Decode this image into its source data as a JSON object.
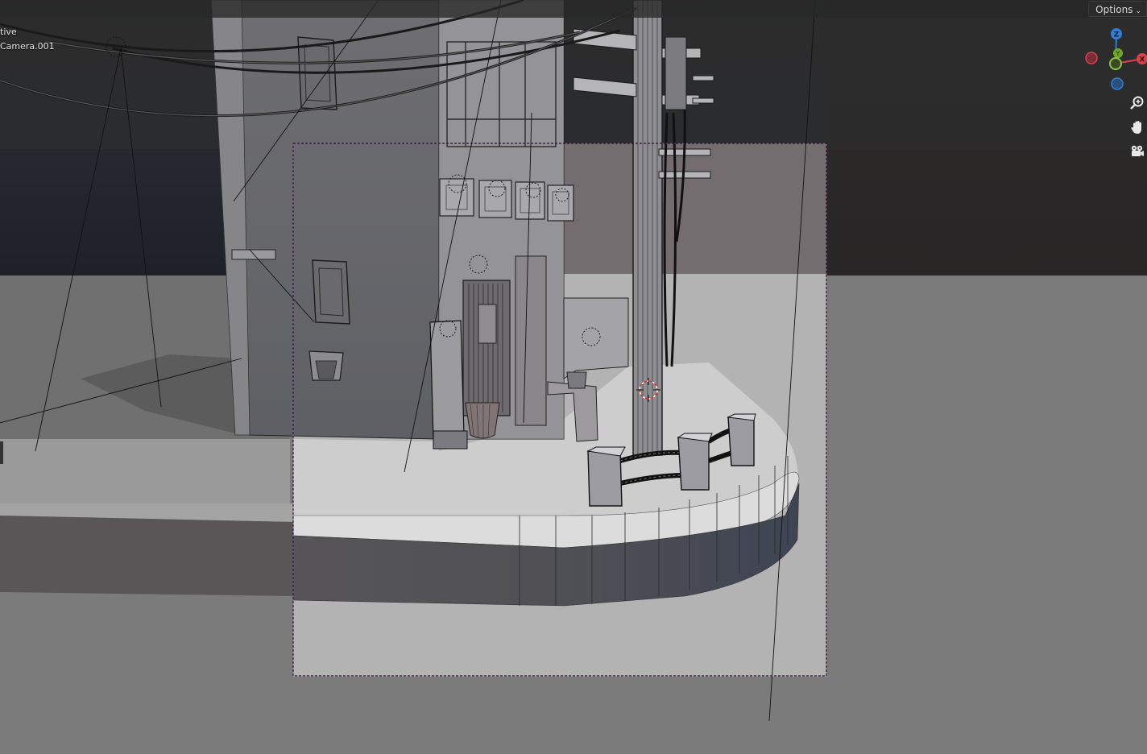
{
  "header": {
    "options_label": "Options"
  },
  "viewport_info": {
    "mode_text": "tive",
    "object_text": "Camera.001"
  },
  "gizmo": {
    "z_label": "Z",
    "y_label": "Y",
    "x_label": "X",
    "colors": {
      "x": "#d9424c",
      "y": "#6fa823",
      "z": "#2f7fd6"
    }
  },
  "nav_tools": [
    {
      "icon": "zoom-icon"
    },
    {
      "icon": "hand-pan-icon"
    },
    {
      "icon": "camera-view-icon"
    }
  ]
}
